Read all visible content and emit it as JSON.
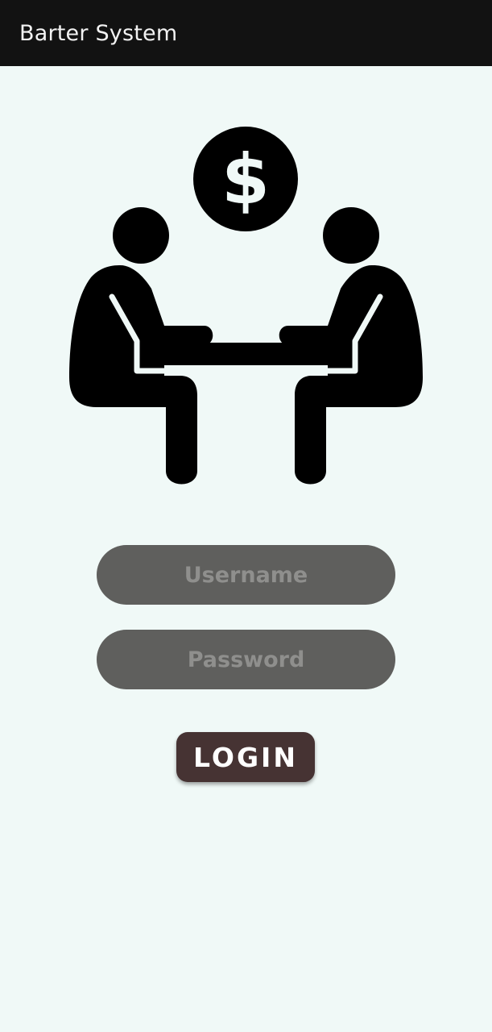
{
  "app_bar": {
    "title": "Barter System"
  },
  "illustration": {
    "icon": "people-trading-icon",
    "currency_symbol": "$",
    "color": "#000000"
  },
  "login_form": {
    "username_placeholder": "Username",
    "password_placeholder": "Password",
    "login_label": "LOGIN"
  },
  "colors": {
    "app_bar": "#121212",
    "background": "#f0f9f7",
    "field": "#5f5f5d",
    "field_text": "#8f8f8d",
    "button": "#463333"
  }
}
